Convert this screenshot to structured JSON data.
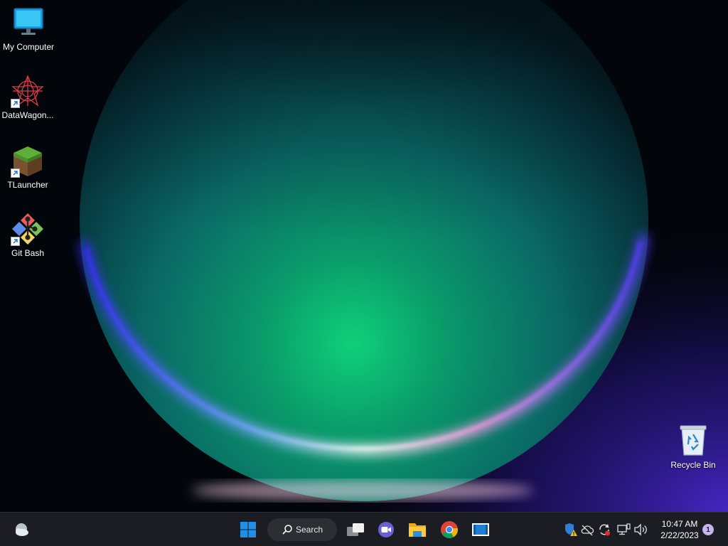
{
  "desktop": {
    "icons": [
      {
        "label": "My Computer",
        "icon": "monitor-icon"
      },
      {
        "label": "DataWagon...",
        "icon": "datawagon-icon"
      },
      {
        "label": "TLauncher",
        "icon": "minecraft-grass-block-icon"
      },
      {
        "label": "Git Bash",
        "icon": "git-logo-icon"
      },
      {
        "label": "Recycle Bin",
        "icon": "recycle-bin-icon"
      }
    ]
  },
  "taskbar": {
    "widgets_icon": "weather-cloud-icon",
    "start_icon": "windows-logo-icon",
    "search_label": "Search",
    "pinned": [
      {
        "name": "task-view",
        "icon": "task-view-icon"
      },
      {
        "name": "teams-chat",
        "icon": "video-chat-icon"
      },
      {
        "name": "file-explorer",
        "icon": "folder-icon"
      },
      {
        "name": "chrome",
        "icon": "chrome-icon"
      },
      {
        "name": "media-player",
        "icon": "media-player-icon"
      }
    ],
    "tray": [
      {
        "icon": "security-warning-icon"
      },
      {
        "icon": "cloud-offline-icon"
      },
      {
        "icon": "sync-error-icon"
      },
      {
        "icon": "network-icon"
      },
      {
        "icon": "volume-icon"
      }
    ],
    "clock": {
      "time": "10:47 AM",
      "date": "2/22/2023"
    },
    "notification_count": "1"
  },
  "colors": {
    "taskbar_bg": "#1c1d22",
    "accent_blue": "#1f8fe8",
    "bloom_green": "#1fe08a",
    "bloom_purple": "#7a3cff"
  }
}
